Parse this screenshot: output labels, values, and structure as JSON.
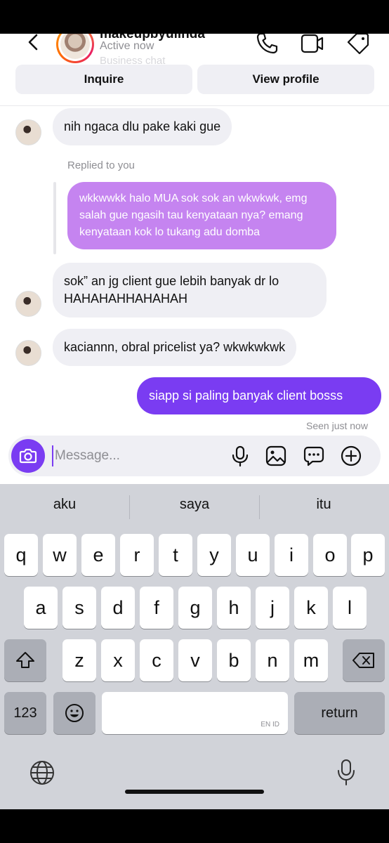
{
  "header": {
    "username": "makeupbyulinda",
    "status": "Active now",
    "subtitle": "Business chat",
    "inquire_label": "Inquire",
    "view_profile_label": "View profile"
  },
  "messages": {
    "m1": "nih ngaca dlu pake kaki gue",
    "replied_label": "Replied to you",
    "reply_text": "wkkwwkk halo MUA sok sok an wkwkwk, emg salah gue ngasih tau kenyataan nya? emang kenyataan kok lo tukang adu domba",
    "m2": "sok” an jg client gue lebih banyak dr lo HAHAHAHHAHAHAH",
    "m3": "kaciannn, obral pricelist ya? wkwkwkwk",
    "m4": "siapp si paling banyak client bosss",
    "seen": "Seen just now"
  },
  "composer": {
    "placeholder": "Message..."
  },
  "keyboard": {
    "suggestions": [
      "aku",
      "saya",
      "itu"
    ],
    "row1": [
      "q",
      "w",
      "e",
      "r",
      "t",
      "y",
      "u",
      "i",
      "o",
      "p"
    ],
    "row2": [
      "a",
      "s",
      "d",
      "f",
      "g",
      "h",
      "j",
      "k",
      "l"
    ],
    "row3": [
      "z",
      "x",
      "c",
      "v",
      "b",
      "n",
      "m"
    ],
    "numbers_label": "123",
    "return_label": "return",
    "space_hint": "EN ID"
  },
  "colors": {
    "accent": "#7a3cf2",
    "reply_bubble": "#c27ef0",
    "incoming_bubble": "#efeff4",
    "keyboard_bg": "#d1d3d9"
  }
}
